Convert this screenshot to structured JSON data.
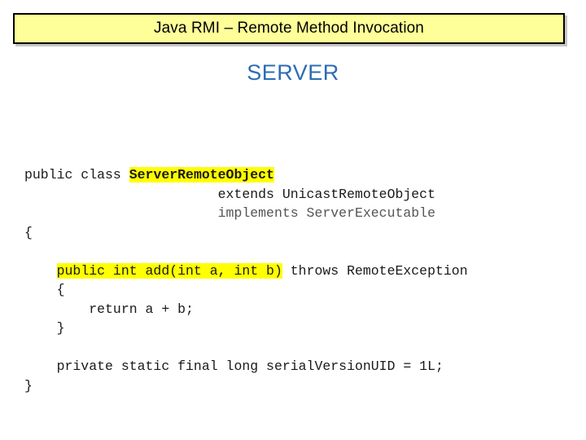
{
  "slide": {
    "title": "Java RMI – Remote Method Invocation",
    "heading": "SERVER",
    "colors": {
      "title_background": "#ffff99",
      "title_border": "#000000",
      "heading_text": "#2d6cb4",
      "highlight": "#ffff00",
      "code_text": "#1a1a1a",
      "page_background": "#ffffff"
    }
  },
  "code": {
    "language": "java",
    "lines": [
      {
        "id": "line-class-declaration",
        "segments": [
          {
            "text": "public class ",
            "style": "plain"
          },
          {
            "text": "ServerRemoteObject",
            "style": "highlight-bold"
          }
        ]
      },
      {
        "id": "line-extends",
        "segments": [
          {
            "text": "                        extends UnicastRemoteObject",
            "style": "plain"
          }
        ]
      },
      {
        "id": "line-implements",
        "segments": [
          {
            "text": "                        implements ServerExecutable",
            "style": "dim"
          }
        ]
      },
      {
        "id": "line-class-open-brace",
        "segments": [
          {
            "text": "{",
            "style": "plain"
          }
        ]
      },
      {
        "id": "line-blank-1",
        "segments": [
          {
            "text": "",
            "style": "plain"
          }
        ]
      },
      {
        "id": "line-method-signature",
        "segments": [
          {
            "text": "    ",
            "style": "plain"
          },
          {
            "text": "public int add(int a, int b)",
            "style": "highlight"
          },
          {
            "text": " throws RemoteException",
            "style": "plain"
          }
        ]
      },
      {
        "id": "line-method-open-brace",
        "segments": [
          {
            "text": "    {",
            "style": "plain"
          }
        ]
      },
      {
        "id": "line-return",
        "segments": [
          {
            "text": "        return a + b;",
            "style": "plain"
          }
        ]
      },
      {
        "id": "line-method-close-brace",
        "segments": [
          {
            "text": "    }",
            "style": "plain"
          }
        ]
      },
      {
        "id": "line-blank-2",
        "segments": [
          {
            "text": "",
            "style": "plain"
          }
        ]
      },
      {
        "id": "line-serial-version-uid",
        "segments": [
          {
            "text": "    private static final long serialVersionUID = 1L;",
            "style": "plain"
          }
        ]
      },
      {
        "id": "line-class-close-brace",
        "segments": [
          {
            "text": "}",
            "style": "plain"
          }
        ]
      }
    ]
  }
}
